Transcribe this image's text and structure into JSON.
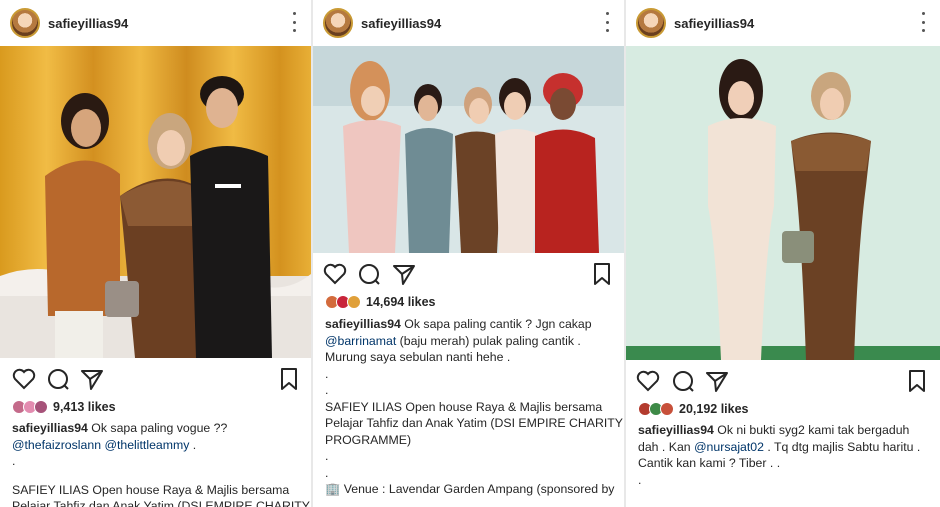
{
  "panels": [
    {
      "username": "safieyillias94",
      "likes": "9,413 likes",
      "caption": {
        "user": "safieyillias94",
        "text": " Ok sapa paling vogue ??",
        "mention1": "@thefaizroslann",
        "mention2": "@thelittleammy",
        "end": " .",
        "dot": ".",
        "line4": "SAFIEY ILIAS Open house Raya & Majlis bersama",
        "line5": "Pelajar Tahfiz dan Anak Yatim (DSI EMPIRE CHARITY"
      }
    },
    {
      "username": "safieyillias94",
      "likes": "14,694 likes",
      "caption": {
        "user": "safieyillias94",
        "text": " Ok sapa paling cantik ? Jgn cakap",
        "mention1": "@barrinamat",
        "after_mention": " (baju merah) pulak paling cantik .",
        "line3": "Murung saya sebulan nanti hehe .",
        "dot1": ".",
        "dot2": ".",
        "line6": "SAFIEY ILIAS Open house Raya & Majlis bersama",
        "line7": "Pelajar Tahfiz dan Anak Yatim (DSI EMPIRE CHARITY",
        "line8": "PROGRAMME)",
        "dot3": ".",
        "dot4": ".",
        "venue": "🏢 Venue : Lavendar Garden Ampang (sponsored by"
      }
    },
    {
      "username": "safieyillias94",
      "likes": "20,192 likes",
      "caption": {
        "user": "safieyillias94",
        "text": " Ok ni bukti syg2 kami tak bergaduh",
        "line2a": "dah . Kan ",
        "mention1": "@nursajat02",
        "line2b": " . Tq dtg majlis Sabtu haritu .",
        "line3": "Cantik kan kami ? Tiber . .",
        "dot": "."
      }
    }
  ],
  "icons": [
    "heart-icon",
    "comment-icon",
    "share-icon",
    "bookmark-icon",
    "more-options-icon"
  ],
  "colors": {
    "mention": "#003569",
    "text": "#262626",
    "avatar_ring": "#c99a34"
  }
}
